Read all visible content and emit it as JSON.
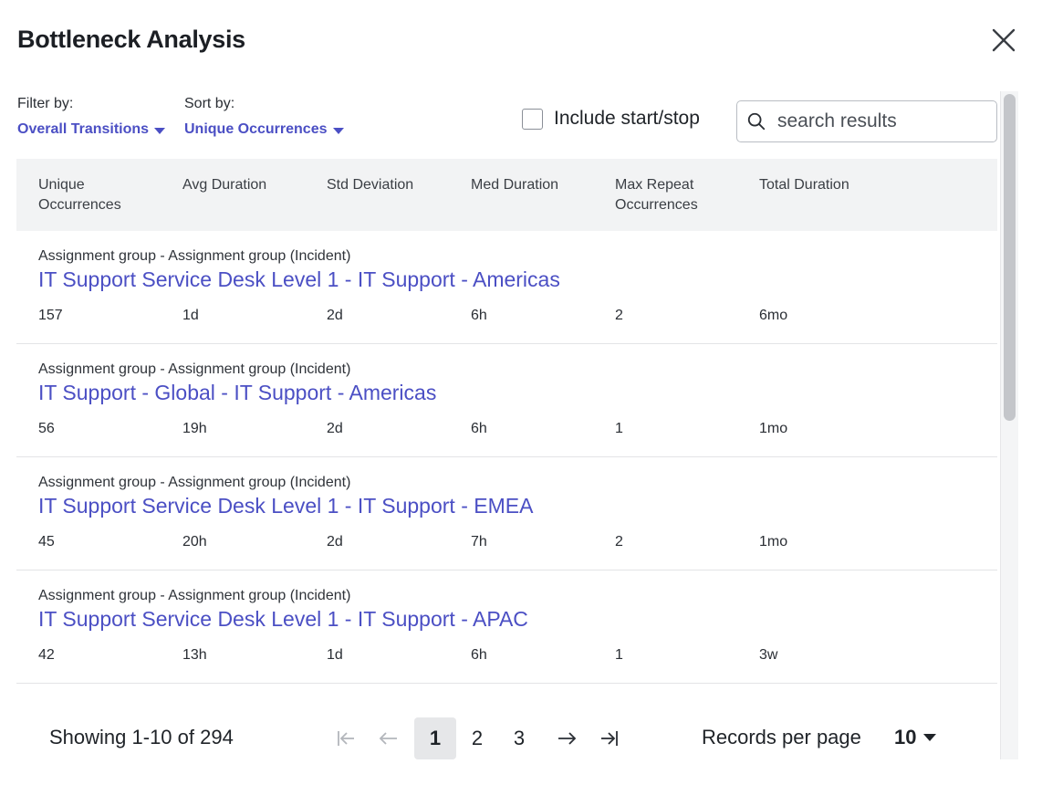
{
  "dialog": {
    "title": "Bottleneck Analysis",
    "close_icon": "close-icon"
  },
  "filters": {
    "filter_label": "Filter by:",
    "filter_value": "Overall Transitions",
    "sort_label": "Sort by:",
    "sort_value": "Unique Occurrences"
  },
  "include_start_stop": {
    "label": "Include start/stop",
    "checked": false
  },
  "search": {
    "placeholder": "search results",
    "value": "",
    "icon": "search-icon"
  },
  "table": {
    "columns": [
      "Unique\nOccurrences",
      "Avg Duration",
      "Std Deviation",
      "Med Duration",
      "Max Repeat\nOccurrences",
      "Total Duration"
    ],
    "rows": [
      {
        "subtitle": "Assignment group - Assignment group (Incident)",
        "link": "IT Support Service Desk Level 1 - IT Support - Americas",
        "values": [
          "157",
          "1d",
          "2d",
          "6h",
          "2",
          "6mo"
        ]
      },
      {
        "subtitle": "Assignment group - Assignment group (Incident)",
        "link": "IT Support - Global - IT Support - Americas",
        "values": [
          "56",
          "19h",
          "2d",
          "6h",
          "1",
          "1mo"
        ]
      },
      {
        "subtitle": "Assignment group - Assignment group (Incident)",
        "link": "IT Support Service Desk Level 1 - IT Support - EMEA",
        "values": [
          "45",
          "20h",
          "2d",
          "7h",
          "2",
          "1mo"
        ]
      },
      {
        "subtitle": "Assignment group - Assignment group (Incident)",
        "link": "IT Support Service Desk Level 1 - IT Support - APAC",
        "values": [
          "42",
          "13h",
          "1d",
          "6h",
          "1",
          "3w"
        ]
      }
    ]
  },
  "pagination": {
    "showing": "Showing 1-10 of 294",
    "pages": [
      "1",
      "2",
      "3"
    ],
    "current_page": "1",
    "records_label": "Records per page",
    "records_value": "10"
  },
  "colors": {
    "accent": "#4b4fc4",
    "header_bg": "#f2f3f4",
    "active_page_bg": "#e6e7e9"
  }
}
